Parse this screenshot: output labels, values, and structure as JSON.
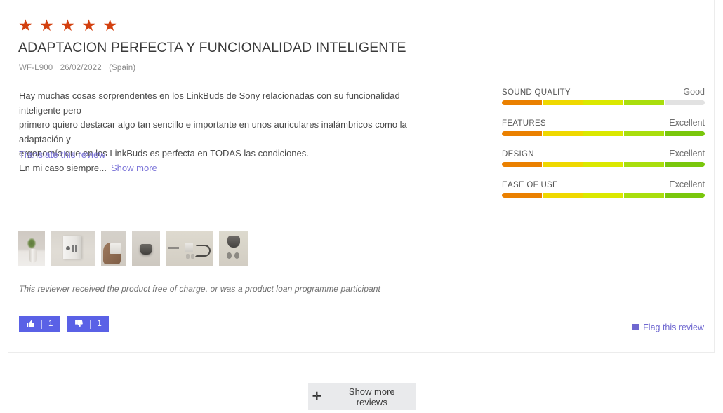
{
  "review": {
    "rating_stars": 5,
    "star_glyph": "★",
    "star_color": "#d3400f",
    "title": "ADAPTACION PERFECTA Y FUNCIONALIDAD INTELIGENTE",
    "meta": {
      "model": "WF-L900",
      "date": "26/02/2022",
      "location": "(Spain)"
    },
    "body_line1": "Hay muchas cosas sorprendentes en los LinkBuds de Sony relacionadas con su funcionalidad inteligente pero",
    "body_line2": "primero quiero destacar algo tan sencillo e importante en unos auriculares inalámbricos como la adaptación y",
    "body_line3": "ergonomía que en los LinkBuds es perfecta en TODAS las condiciones.",
    "body_line4": "En mi caso siempre...",
    "show_more_label": "Show more",
    "translate_label": "Translate this review",
    "disclosure": "This reviewer received the product free of charge, or was a product loan programme participant",
    "link_color": "#7b74d8"
  },
  "ratings": {
    "max_segments": 5,
    "items": [
      {
        "label": "SOUND QUALITY",
        "value": "Good",
        "filled": 4
      },
      {
        "label": "FEATURES",
        "value": "Excellent",
        "filled": 5
      },
      {
        "label": "DESIGN",
        "value": "Excellent",
        "filled": 5
      },
      {
        "label": "EASE OF USE",
        "value": "Excellent",
        "filled": 5
      }
    ],
    "segment_colors": [
      "#ea8000",
      "#efd800",
      "#dbe800",
      "#a9de0d",
      "#7ac70c"
    ],
    "empty_color": "#e2e2e2"
  },
  "thumbnails": [
    {
      "name": "review-photo-1",
      "alt": "White vase with green plant on a table"
    },
    {
      "name": "review-photo-2",
      "alt": "Product box mounted on wall"
    },
    {
      "name": "review-photo-3",
      "alt": "Hand holding the product box"
    },
    {
      "name": "review-photo-4",
      "alt": "Charging case close up"
    },
    {
      "name": "review-photo-5",
      "alt": "Accessories laid out including cable"
    },
    {
      "name": "review-photo-6",
      "alt": "Charging case with two earbuds"
    }
  ],
  "votes": {
    "helpful": {
      "icon": "thumbs-up",
      "glyph": "👍",
      "count": "1"
    },
    "not_helpful": {
      "icon": "thumbs-down",
      "glyph": "👎",
      "count": "1"
    },
    "button_color": "#5a61e6"
  },
  "flag": {
    "label": "Flag this review",
    "icon": "flag-icon",
    "color": "#6f68d0"
  },
  "footer": {
    "show_more_reviews_label": "Show more reviews",
    "plus_glyph": "✛",
    "button_bg": "#e9eaec"
  }
}
